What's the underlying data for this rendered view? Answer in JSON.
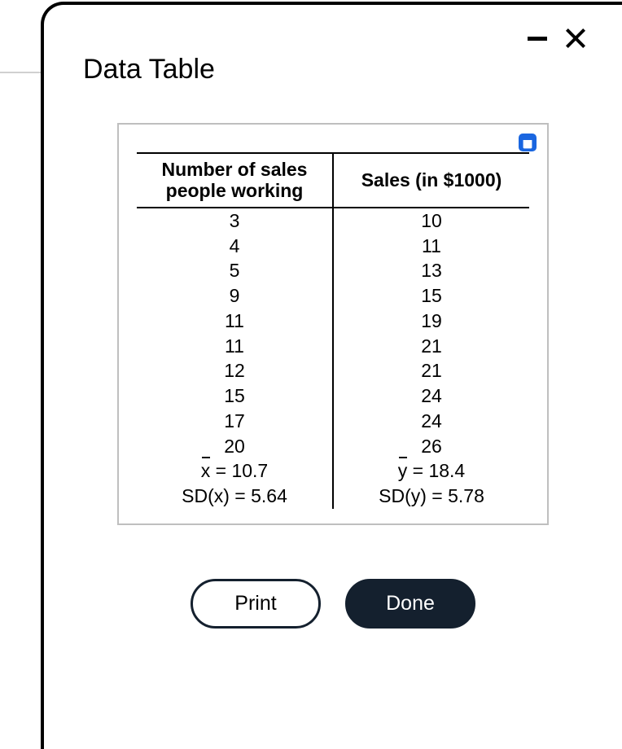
{
  "dialog": {
    "title": "Data Table",
    "icons": {
      "minimize": "minimize",
      "close": "close",
      "copy": "copy"
    },
    "buttons": {
      "print": "Print",
      "done": "Done"
    }
  },
  "table": {
    "headers": {
      "col1_line1": "Number of sales",
      "col1_line2": "people working",
      "col2": "Sales (in $1000)"
    },
    "rows": [
      {
        "x": "3",
        "y": "10"
      },
      {
        "x": "4",
        "y": "11"
      },
      {
        "x": "5",
        "y": "13"
      },
      {
        "x": "9",
        "y": "15"
      },
      {
        "x": "11",
        "y": "19"
      },
      {
        "x": "11",
        "y": "21"
      },
      {
        "x": "12",
        "y": "21"
      },
      {
        "x": "15",
        "y": "24"
      },
      {
        "x": "17",
        "y": "24"
      },
      {
        "x": "20",
        "y": "26"
      }
    ],
    "stats": {
      "x_mean": {
        "var": "x",
        "label_suffix": " = 10.7"
      },
      "y_mean": {
        "var": "y",
        "label_suffix": " = 18.4"
      },
      "sd_x": "SD(x) = 5.64",
      "sd_y": "SD(y) = 5.78"
    }
  },
  "chart_data": {
    "type": "table",
    "columns": [
      "Number of sales people working",
      "Sales (in $1000)"
    ],
    "x": [
      3,
      4,
      5,
      9,
      11,
      11,
      12,
      15,
      17,
      20
    ],
    "y": [
      10,
      11,
      13,
      15,
      19,
      21,
      21,
      24,
      24,
      26
    ],
    "summary": {
      "x_mean": 10.7,
      "y_mean": 18.4,
      "sd_x": 5.64,
      "sd_y": 5.78
    }
  }
}
